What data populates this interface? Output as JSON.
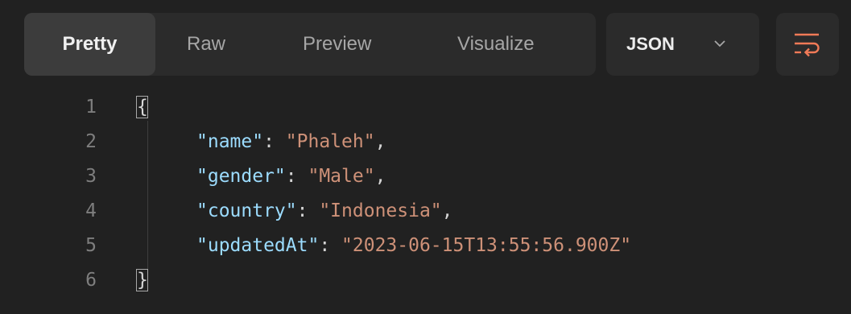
{
  "tabs": {
    "pretty": "Pretty",
    "raw": "Raw",
    "preview": "Preview",
    "visualize": "Visualize"
  },
  "format": {
    "selected": "JSON"
  },
  "icons": {
    "chevron": "chevron-down-icon",
    "wrap": "wrap-lines-icon"
  },
  "colors": {
    "key": "#9cdcfe",
    "string": "#ce9178",
    "line_number": "#7e7e7e",
    "background": "#212121"
  },
  "code": {
    "line_numbers": [
      "1",
      "2",
      "3",
      "4",
      "5",
      "6"
    ],
    "open_brace": "{",
    "close_brace": "}",
    "colon": ": ",
    "comma": ",",
    "entries": [
      {
        "key": "\"name\"",
        "value": "\"Phaleh\"",
        "comma": ","
      },
      {
        "key": "\"gender\"",
        "value": "\"Male\"",
        "comma": ","
      },
      {
        "key": "\"country\"",
        "value": "\"Indonesia\"",
        "comma": ","
      },
      {
        "key": "\"updatedAt\"",
        "value": "\"2023-06-15T13:55:56.900Z\"",
        "comma": ""
      }
    ]
  }
}
